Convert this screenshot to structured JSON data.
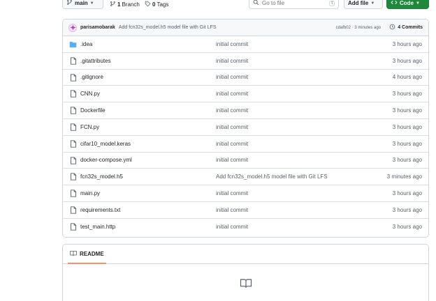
{
  "toolbar": {
    "branch_label": "main",
    "branches_count": "1",
    "branches_label": "Branch",
    "tags_count": "0",
    "tags_label": "Tags",
    "search_placeholder": "Go to file",
    "search_shortcut": "t",
    "add_file_label": "Add file",
    "code_label": "Code"
  },
  "latest_commit": {
    "author": "parisamobarak",
    "message": "Add fcn32s_model.h5 model file with Git LFS",
    "meta": "cdafb02 · 3 minutes ago",
    "commits_label": "4 Commits"
  },
  "files": [
    {
      "name": ".idea",
      "type": "folder",
      "message": "initial commit",
      "time": "3 hours ago"
    },
    {
      "name": ".gitattributes",
      "type": "file",
      "message": "initial commit",
      "time": "3 hours ago"
    },
    {
      "name": ".gitignore",
      "type": "file",
      "message": "initial commit",
      "time": "4 hours ago"
    },
    {
      "name": "CNN.py",
      "type": "file",
      "message": "initial commit",
      "time": "3 hours ago"
    },
    {
      "name": "Dockerfile",
      "type": "file",
      "message": "initial commit",
      "time": "3 hours ago"
    },
    {
      "name": "FCN.py",
      "type": "file",
      "message": "initial commit",
      "time": "3 hours ago"
    },
    {
      "name": "cifar10_model.keras",
      "type": "file",
      "message": "initial commit",
      "time": "3 hours ago"
    },
    {
      "name": "docker-compose.yml",
      "type": "file",
      "message": "initial commit",
      "time": "3 hours ago"
    },
    {
      "name": "fcn32s_model.h5",
      "type": "file",
      "message": "Add fcn32s_model.h5 model file with Git LFS",
      "time": "3 minutes ago"
    },
    {
      "name": "main.py",
      "type": "file",
      "message": "initial commit",
      "time": "3 hours ago"
    },
    {
      "name": "requirements.txt",
      "type": "file",
      "message": "initial commit",
      "time": "3 hours ago"
    },
    {
      "name": "test_main.http",
      "type": "file",
      "message": "initial commit",
      "time": "3 hours ago"
    }
  ],
  "readme": {
    "tab_label": "README"
  },
  "colors": {
    "code_button": "#1f883d",
    "folder_icon": "#54aeff",
    "tab_underline": "#fd8c73"
  }
}
